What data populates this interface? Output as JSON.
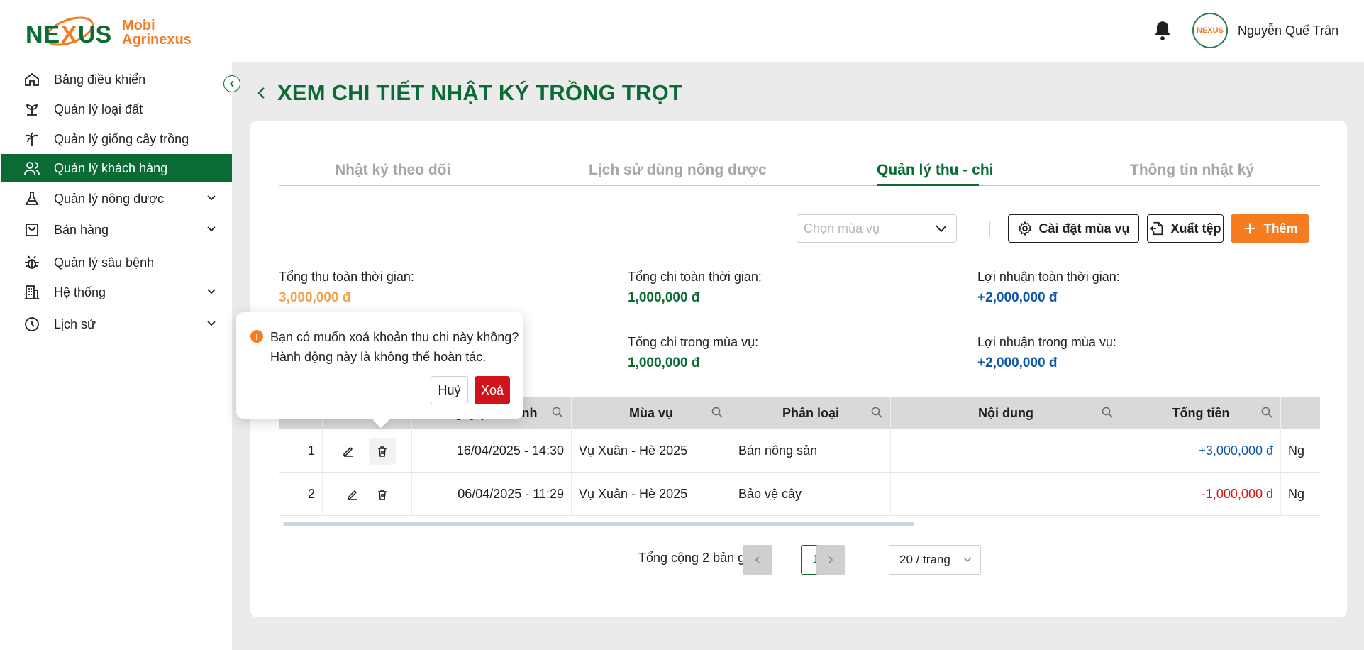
{
  "app": {
    "logo_word": "NEXUS",
    "logo_line1": "Mobi",
    "logo_line2": "Agrinexus",
    "avatar_text": "NEXUS",
    "user_name": "Nguyễn Quế Trân"
  },
  "sidebar": {
    "items": [
      {
        "label": "Bảng điều khiển",
        "icon": "home-icon",
        "has_submenu": false
      },
      {
        "label": "Quản lý loại đất",
        "icon": "sprout-icon",
        "has_submenu": false
      },
      {
        "label": "Quản lý giống cây trồng",
        "icon": "palm-tree-icon",
        "has_submenu": false
      },
      {
        "label": "Quản lý khách hàng",
        "icon": "users-icon",
        "has_submenu": false,
        "active": true
      },
      {
        "label": "Quản lý nông dược",
        "icon": "flask-icon",
        "has_submenu": true
      },
      {
        "label": "Bán hàng",
        "icon": "shopping-bag-icon",
        "has_submenu": true
      },
      {
        "label": "Quản lý sâu bệnh",
        "icon": "bug-icon",
        "has_submenu": false
      },
      {
        "label": "Hệ thống",
        "icon": "building-icon",
        "has_submenu": true
      },
      {
        "label": "Lịch sử",
        "icon": "clock-icon",
        "has_submenu": true
      }
    ]
  },
  "page": {
    "title": "XEM CHI TIẾT NHẬT KÝ TRỒNG TRỌT"
  },
  "tabs": [
    {
      "label": "Nhật ký theo dõi",
      "active": false
    },
    {
      "label": "Lịch sử dùng nông dược",
      "active": false
    },
    {
      "label": "Quản lý thu - chi",
      "active": true
    },
    {
      "label": "Thông tin nhật ký",
      "active": false
    }
  ],
  "toolbar": {
    "season_placeholder": "Chọn mùa vụ",
    "settings_label": "Cài đặt mùa vụ",
    "export_label": "Xuất tệp",
    "add_label": "Thêm"
  },
  "stats": {
    "total_income_label": "Tổng thu toàn thời gian:",
    "total_income_value": "3,000,000 đ",
    "total_expense_label": "Tổng chi toàn thời gian:",
    "total_expense_value": "1,000,000 đ",
    "total_profit_label": "Lợi nhuận toàn thời gian:",
    "total_profit_value": "+2,000,000 đ",
    "season_expense_label": "Tổng chi trong mùa vụ:",
    "season_expense_value": "1,000,000 đ",
    "season_profit_label": "Lợi nhuận trong mùa vụ:",
    "season_profit_value": "+2,000,000 đ"
  },
  "colors": {
    "brand_green": "#0b6b34",
    "accent_orange": "#f57c1f",
    "income_orange": "#f5a04a",
    "profit_blue": "#0d57a8",
    "negative_red": "#d0121b"
  },
  "table": {
    "columns": [
      "",
      "",
      "Ngày phát sinh",
      "Mùa vụ",
      "Phân loại",
      "Nội dung",
      "Tổng tiền",
      ""
    ],
    "rows": [
      {
        "stt": "1",
        "date": "16/04/2025 - 14:30",
        "season": "Vụ Xuân - Hè 2025",
        "category": "Bán nông sản",
        "content": "",
        "amount": "+3,000,000 đ",
        "extra": "Ng"
      },
      {
        "stt": "2",
        "date": "06/04/2025 - 11:29",
        "season": "Vụ Xuân - Hè 2025",
        "category": "Bảo vệ cây",
        "content": "",
        "amount": "-1,000,000 đ",
        "extra": "Ng"
      }
    ]
  },
  "pagination": {
    "total_text": "Tổng cộng 2 bản ghi",
    "current_page": "1",
    "page_size": "20 / trang"
  },
  "popconfirm": {
    "line1": "Bạn có muốn xoá khoản thu chi này không?",
    "line2": "Hành động này là không thể hoàn tác.",
    "cancel_label": "Huỷ",
    "ok_label": "Xoá"
  }
}
